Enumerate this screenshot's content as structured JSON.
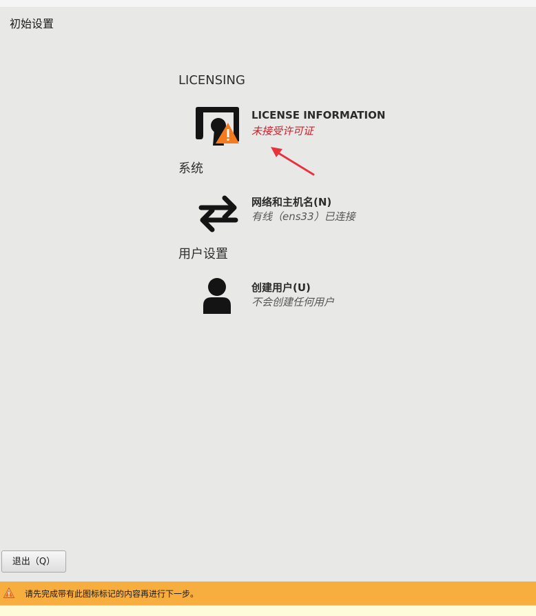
{
  "window": {
    "title": "初始设置"
  },
  "sections": [
    {
      "title": "LICENSING",
      "spokes": [
        {
          "icon": "license-warning-icon",
          "title": "LICENSE INFORMATION",
          "status": "未接受许可证",
          "status_color": "#d0202a"
        }
      ]
    },
    {
      "title": "系统",
      "spokes": [
        {
          "icon": "network-arrows-icon",
          "title": "网络和主机名(N)",
          "status": "有线（ens33）已连接"
        }
      ]
    },
    {
      "title": "用户设置",
      "spokes": [
        {
          "icon": "user-icon",
          "title": "创建用户(U)",
          "status": "不会创建任何用户"
        }
      ]
    }
  ],
  "buttons": {
    "quit_label": "退出（Q）"
  },
  "infobar": {
    "icon": "warning-icon",
    "message": "请先完成带有此图标标记的内容再进行下一步。",
    "background": "#f8ad3f"
  },
  "colors": {
    "window_bg": "#e8e8e7",
    "warning_orange": "#f47b20",
    "annotation_red": "#e8323c"
  }
}
